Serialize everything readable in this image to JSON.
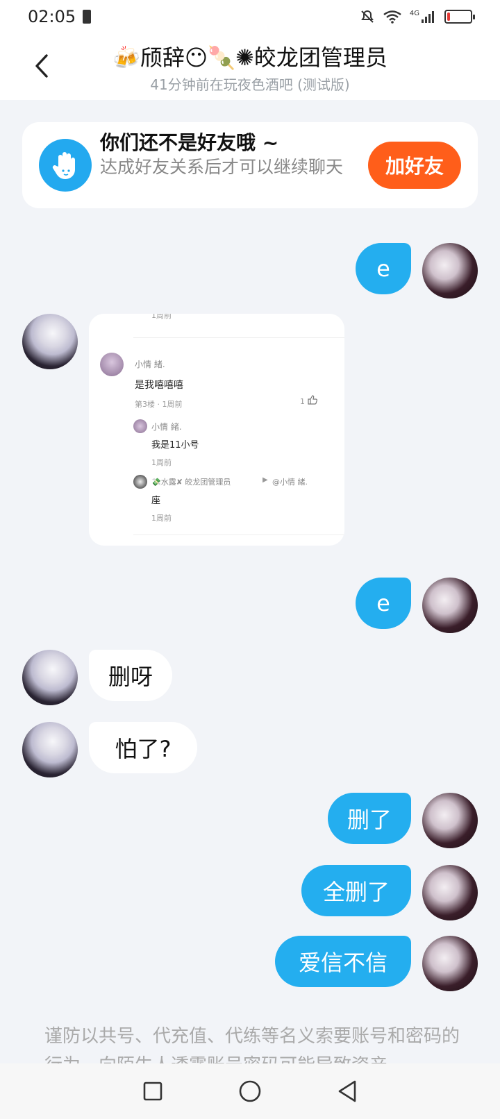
{
  "status_bar": {
    "time": "02:05",
    "network": "4G",
    "battery_level": 0.12
  },
  "header": {
    "title": "🍻颀辞😶🍡✺皎龙团管理员",
    "subtitle": "41分钟前在玩夜色酒吧 (测试版)"
  },
  "friend_banner": {
    "title": "你们还不是好友哦 ~",
    "description": "达成好友关系后才可以继续聊天",
    "add_button": "加好友"
  },
  "messages": [
    {
      "side": "out",
      "text": "e"
    },
    {
      "side": "in",
      "type": "image"
    },
    {
      "side": "out",
      "text": "e"
    },
    {
      "side": "in",
      "text": "删呀"
    },
    {
      "side": "in",
      "text": "怕了?"
    },
    {
      "side": "out",
      "text": "删了"
    },
    {
      "side": "out",
      "text": "全删了"
    },
    {
      "side": "out",
      "text": "爱信不信"
    }
  ],
  "image_message": {
    "top_time": "1周前",
    "comment_author": "小情 緒.",
    "comment_text": "是我嘻嘻嘻",
    "comment_meta": "第3楼 · 1周前",
    "like_count": "1",
    "reply1_author": "小情 緒.",
    "reply1_text": "我是11小号",
    "reply1_time": "1周前",
    "reply2_author": "💸水露✘ 皎龙团管理员",
    "reply2_target": "@小情 緒.",
    "reply2_text": "座",
    "reply2_time": "1周前"
  },
  "notice": "谨防以共号、代充值、代练等名义索要账号和密码的行为，向陌生人透露账号密码可能导致资产",
  "colors": {
    "accent_blue": "#24aeef",
    "add_button_orange": "#ff5e1a",
    "background": "#f2f4f8"
  }
}
